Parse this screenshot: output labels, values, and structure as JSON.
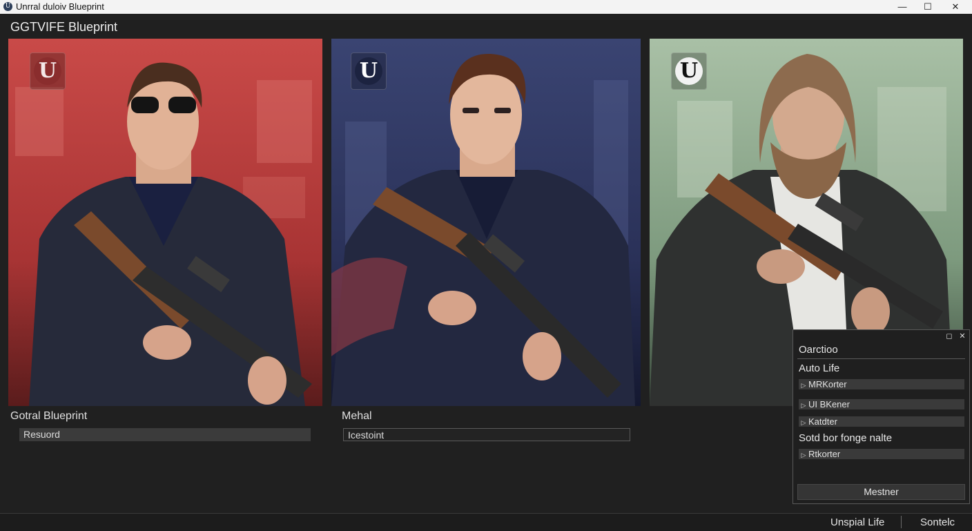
{
  "window": {
    "app_icon_glyph": "U",
    "title": "Unrral duloiv Blueprint",
    "controls": {
      "minimize": "—",
      "maximize": "☐",
      "close": "✕"
    }
  },
  "header": {
    "title": "GGTVIFE Blueprint"
  },
  "cards": [
    {
      "label": "Gotral Blueprint",
      "field_value": "Resuord",
      "background": "#b83a3a",
      "logo_color": "#8a2d2d"
    },
    {
      "label": "Mehal",
      "field_value": "Icestoint",
      "background": "#2c3358",
      "logo_color": "#1c2340"
    },
    {
      "label": "",
      "field_value": "",
      "background": "#7d9a7e",
      "logo_color": "#f2f2f2"
    }
  ],
  "logo_glyph": "U",
  "panel": {
    "controls": {
      "restore": "◻",
      "close": "✕"
    },
    "title": "Oarctioo",
    "section1": "Auto Life",
    "rows1": [
      "MRKorter",
      "UI BKener",
      "Katdter"
    ],
    "section2": "Sotd bor fonge nalte",
    "rows2": [
      "Rtkorter"
    ],
    "button": "Mestner",
    "row_icon": "▷"
  },
  "statusbar": {
    "left": "Unspial Life",
    "right": "Sontelc"
  },
  "colors": {
    "background": "#202020",
    "panel_row": "#3a3a3a",
    "titlebar": "#f3f3f3"
  }
}
